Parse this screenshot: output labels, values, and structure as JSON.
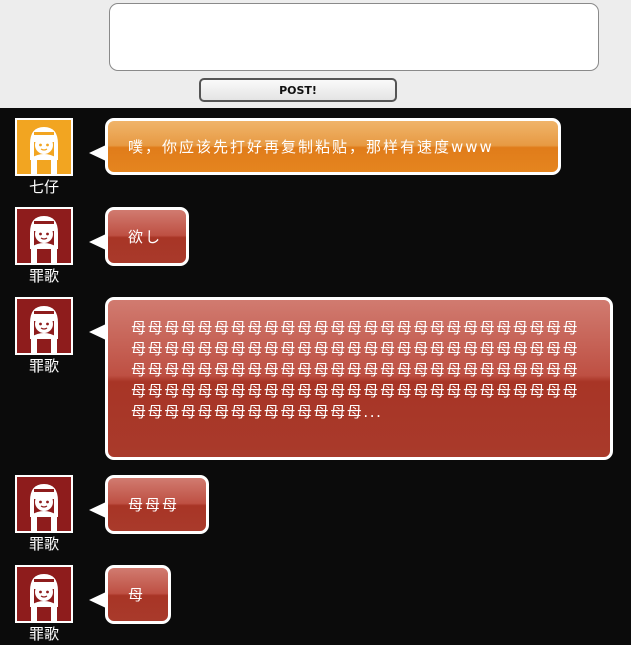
{
  "composer": {
    "input_value": "",
    "post_label": "POST!"
  },
  "colors": {
    "orange_bubble": "#e08a2a",
    "red_bubble": "#a83526",
    "avatar_orange_bg": "#f0a020",
    "avatar_red_bg": "#8e1c1c"
  },
  "messages": [
    {
      "user": "七仔",
      "avatar_icon": "nun-avatar-orange",
      "text": "噗，你应该先打好再复制粘贴，那样有速度www"
    },
    {
      "user": "罪歌",
      "avatar_icon": "nun-avatar-red",
      "text": "欲し"
    },
    {
      "user": "罪歌",
      "avatar_icon": "nun-avatar-red",
      "text": "母母母母母母母母母母母母母母母母母母母母母母母母母母母母母母母母母母母母母母母母母母母母母母母母母母母母母母母母母母母母母母母母母母母母母母母母母母母母母母母母母母母母母母母母母母母母母母母母母母母母母母母母母母母母母母母母母母母母母母母母母母..."
    },
    {
      "user": "罪歌",
      "avatar_icon": "nun-avatar-red",
      "text": "母母母"
    },
    {
      "user": "罪歌",
      "avatar_icon": "nun-avatar-red",
      "text": "母"
    }
  ]
}
